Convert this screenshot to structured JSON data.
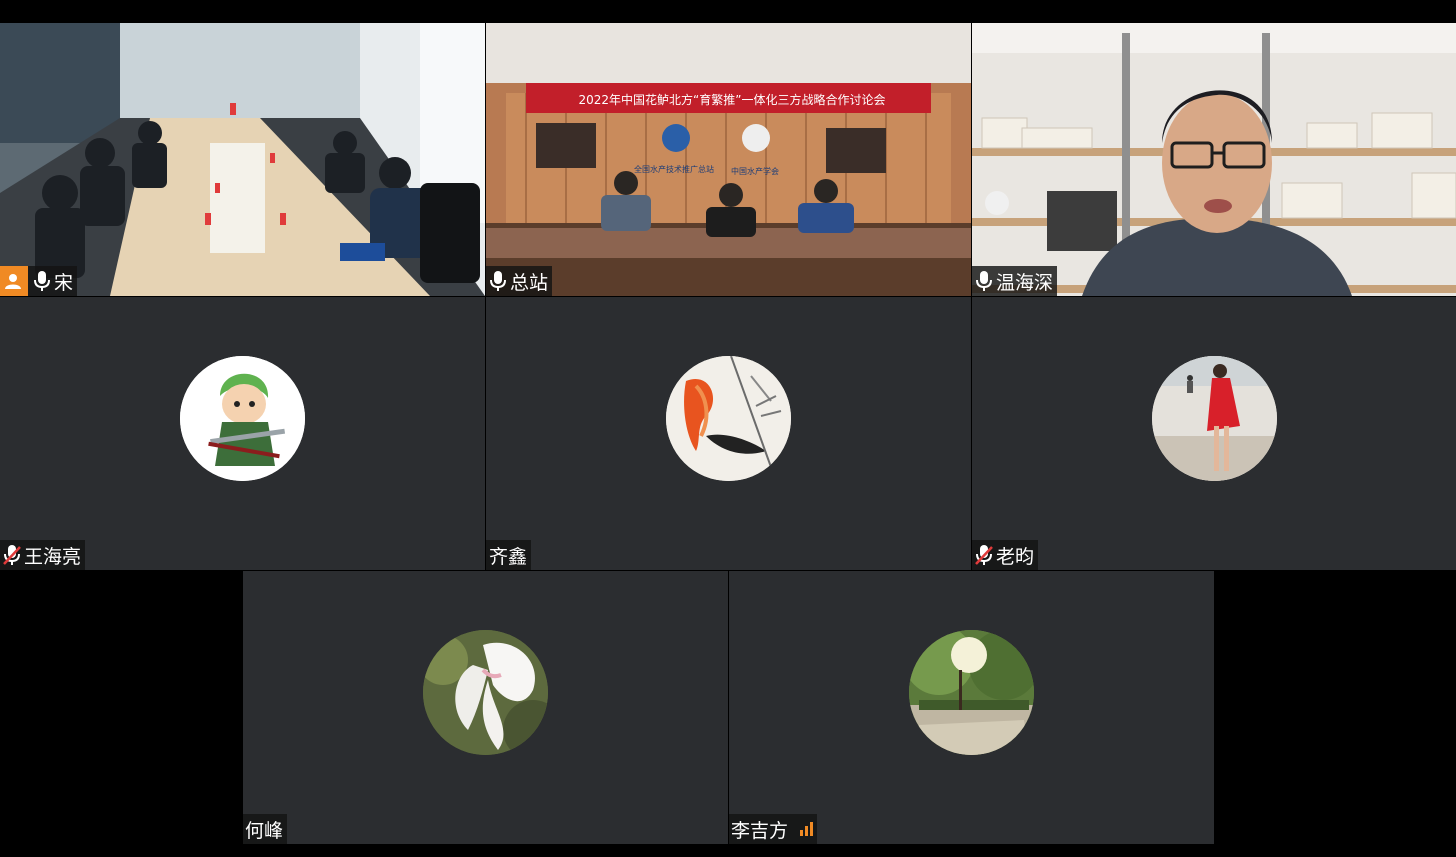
{
  "participants": [
    {
      "name": "宋",
      "mic": "on",
      "host": true
    },
    {
      "name": "总站",
      "mic": "on",
      "banner": "2022年中国花鲈北方“育繁推”一体化三方战略合作讨论会",
      "sign_left": "全国水产技术推广总站",
      "sign_right": "中国水产学会"
    },
    {
      "name": "温海深",
      "mic": "on",
      "speaking": true
    },
    {
      "name": "王海亮",
      "mic": "muted"
    },
    {
      "name": "齐鑫",
      "mic": "none"
    },
    {
      "name": "老昀",
      "mic": "muted"
    },
    {
      "name": "何峰",
      "mic": "none"
    },
    {
      "name": "李吉方",
      "mic": "none",
      "signal": "signal-bars-icon"
    }
  ],
  "colors": {
    "tile_bg": "#2b2d30",
    "accent_orange": "#f08a24",
    "active_border": "#2ecc71"
  }
}
